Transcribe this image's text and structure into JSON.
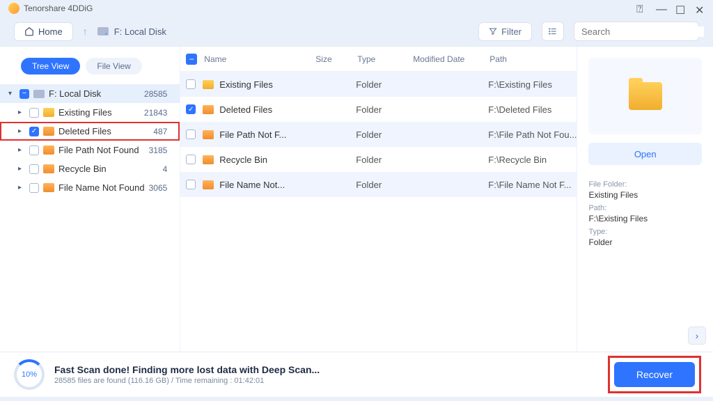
{
  "app": {
    "title": "Tenorshare 4DDiG"
  },
  "toolbar": {
    "home": "Home",
    "drive": "F: Local Disk",
    "filter": "Filter",
    "search_placeholder": "Search"
  },
  "sidebar": {
    "tabs": {
      "tree": "Tree View",
      "file": "File View"
    },
    "root": {
      "label": "F: Local Disk",
      "count": "28585"
    },
    "items": [
      {
        "label": "Existing Files",
        "count": "21843",
        "checked": false,
        "color": "yellow"
      },
      {
        "label": "Deleted Files",
        "count": "487",
        "checked": true,
        "color": "orange",
        "highlight": true
      },
      {
        "label": "File Path Not Found",
        "count": "3185",
        "checked": false,
        "color": "orange"
      },
      {
        "label": "Recycle Bin",
        "count": "4",
        "checked": false,
        "color": "orange"
      },
      {
        "label": "File Name Not Found",
        "count": "3065",
        "checked": false,
        "color": "orange"
      }
    ]
  },
  "table": {
    "headers": {
      "name": "Name",
      "size": "Size",
      "type": "Type",
      "modified": "Modified Date",
      "path": "Path"
    },
    "rows": [
      {
        "name": "Existing Files",
        "type": "Folder",
        "path": "F:\\Existing Files",
        "color": "yellow",
        "checked": false
      },
      {
        "name": "Deleted Files",
        "type": "Folder",
        "path": "F:\\Deleted Files",
        "color": "orange",
        "checked": true
      },
      {
        "name": "File Path Not F...",
        "type": "Folder",
        "path": "F:\\File Path Not Fou...",
        "color": "orange",
        "checked": false
      },
      {
        "name": "Recycle Bin",
        "type": "Folder",
        "path": "F:\\Recycle Bin",
        "color": "orange",
        "checked": false
      },
      {
        "name": "File Name Not...",
        "type": "Folder",
        "path": "F:\\File Name Not F...",
        "color": "orange",
        "checked": false
      }
    ]
  },
  "details": {
    "open": "Open",
    "labels": {
      "folder": "File Folder:",
      "path": "Path:",
      "type": "Type:"
    },
    "values": {
      "folder": "Existing Files",
      "path": "F:\\Existing Files",
      "type": "Folder"
    }
  },
  "footer": {
    "percent": "10%",
    "title": "Fast Scan done! Finding more lost data with Deep Scan...",
    "sub": "28585 files are found (116.16 GB) /  Time remaining : 01:42:01",
    "recover": "Recover"
  }
}
